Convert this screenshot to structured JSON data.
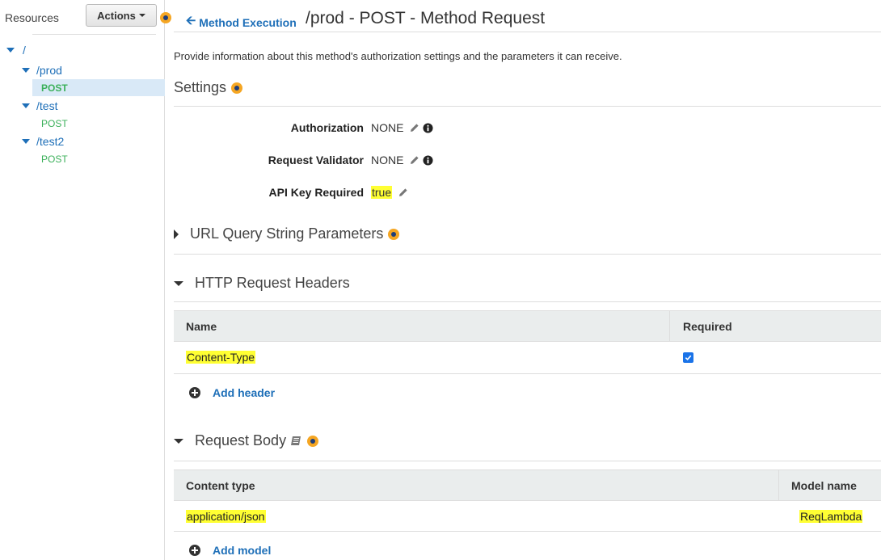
{
  "sidebar": {
    "title": "Resources",
    "actions_label": "Actions",
    "tree": {
      "root": "/",
      "items": [
        {
          "path": "/prod",
          "method": "POST"
        },
        {
          "path": "/test",
          "method": "POST"
        },
        {
          "path": "/test2",
          "method": "POST"
        }
      ]
    }
  },
  "header": {
    "back_label": "Method Execution",
    "title": "/prod - POST - Method Request"
  },
  "description": "Provide information about this method's authorization settings and the parameters it can receive.",
  "settings": {
    "heading": "Settings",
    "authorization": {
      "label": "Authorization",
      "value": "NONE"
    },
    "request_validator": {
      "label": "Request Validator",
      "value": "NONE"
    },
    "api_key_required": {
      "label": "API Key Required",
      "value": "true"
    }
  },
  "url_query": {
    "heading": "URL Query String Parameters"
  },
  "http_headers": {
    "heading": "HTTP Request Headers",
    "columns": [
      "Name",
      "Required"
    ],
    "rows": [
      {
        "name": "Content-Type",
        "required": true
      }
    ],
    "add_label": "Add header"
  },
  "request_body": {
    "heading": "Request Body",
    "columns": [
      "Content type",
      "Model name"
    ],
    "rows": [
      {
        "content_type": "application/json",
        "model_name": "ReqLambda"
      }
    ],
    "add_label": "Add model"
  },
  "colors": {
    "link": "#1e6fb8",
    "method": "#3bb05a",
    "highlight": "#ffff33",
    "selected_row": "#d9e9f7",
    "info_dot": "#f5a623"
  },
  "icons": [
    "back-arrow-icon",
    "pencil-icon",
    "info-circle-icon",
    "plus-circle-icon",
    "book-icon",
    "info-dot-icon",
    "caret-down-icon",
    "checkbox-checked-icon"
  ]
}
